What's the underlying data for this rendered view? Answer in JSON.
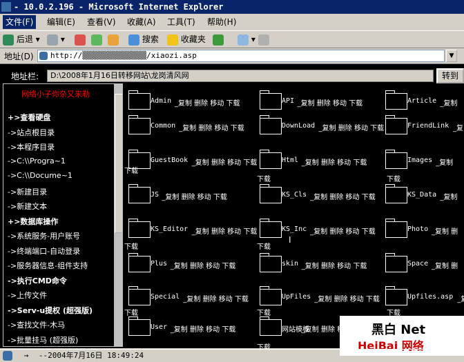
{
  "window": {
    "title": "- 10.0.2.196 - Microsoft Internet Explorer"
  },
  "menu": [
    "文件(F)",
    "编辑(E)",
    "查看(V)",
    "收藏(A)",
    "工具(T)",
    "帮助(H)"
  ],
  "toolbar": {
    "back": "后退",
    "search": "搜索",
    "favorites": "收藏夹"
  },
  "address": {
    "label": "地址(D)",
    "url": "http://▒▒▒▒▒▒▒▒▒▒▒▒▒▒/xiaozi.asp"
  },
  "page": {
    "addr_label": "地址栏:",
    "addr_value": "D:\\2008年1月16日转移网站\\龙岗清风网",
    "go_label": "转到",
    "banner": "网络小子你杂又来勒",
    "sidebar": [
      {
        "text": "+>查看硬盘",
        "bold": true
      },
      {
        "text": "->站点根目录",
        "bold": false
      },
      {
        "text": "->本程序目录",
        "bold": false
      },
      {
        "text": "->C:\\\\Progra~1",
        "bold": false
      },
      {
        "text": "->C:\\\\Docume~1",
        "bold": false
      },
      {
        "text": "->新建目录",
        "bold": false
      },
      {
        "text": "->新建文本",
        "bold": false
      },
      {
        "text": "+>数据库操作",
        "bold": true
      },
      {
        "text": "->系统服务-用户账号",
        "bold": false
      },
      {
        "text": "->终端端口-自动登录",
        "bold": false
      },
      {
        "text": "->服务器信息-组件支持",
        "bold": false
      },
      {
        "text": "->执行CMD命令",
        "bold": true
      },
      {
        "text": "->上传文件",
        "bold": false
      },
      {
        "text": "->Serv-u提权 (超强版)",
        "bold": true
      },
      {
        "text": "->查找文件-木马",
        "bold": false
      },
      {
        "text": "->批量挂马 (超强版)",
        "bold": false
      }
    ],
    "folders": [
      {
        "name": "Admin",
        "acts": "_复制 删除 移动 下载"
      },
      {
        "name": "API",
        "acts": "_复制 删除 移动 下载"
      },
      {
        "name": "Article",
        "acts": "_复制"
      },
      {
        "name": "Common",
        "acts": "_复制 删除 移动 下载"
      },
      {
        "name": "DownLoad",
        "acts": "_复制 删除 移动 下载"
      },
      {
        "name": "FriendLink",
        "acts": "_复"
      },
      {
        "name": "GuestBook",
        "acts": "_复制 删除 移动 下载"
      },
      {
        "name": "Html",
        "acts": "_复制 删除 移动 下载"
      },
      {
        "name": "Images",
        "acts": "_复制"
      },
      {
        "name": "JS",
        "acts": "_复制 删除 移动 下载"
      },
      {
        "name": "KS_Cls",
        "acts": "_复制 删除 移动 下载"
      },
      {
        "name": "KS_Data",
        "acts": "_复制"
      },
      {
        "name": "KS_Editor",
        "acts": "_复制 删除 移动 下载"
      },
      {
        "name": "KS_Inc",
        "acts": "_复制 删除 移动 下载"
      },
      {
        "name": "Photo",
        "acts": "_复制 删"
      },
      {
        "name": "Plus",
        "acts": "_复制 删除 移动 下载"
      },
      {
        "name": "skin",
        "acts": "_复制 删除 移动 下载"
      },
      {
        "name": "Space",
        "acts": "_复制 删"
      },
      {
        "name": "Special",
        "acts": "_复制 删除 移动 下载"
      },
      {
        "name": "UpFiles",
        "acts": "_复制 删除 移动 下载"
      },
      {
        "name": "Upfiles.asp",
        "acts": "_复制"
      },
      {
        "name": "User",
        "acts": "_复制 删除 移动 下载"
      },
      {
        "name": "网站模板",
        "acts": "_复制 删除 移动 下载"
      }
    ],
    "wrap_text": "下载",
    "logo_text": "黑白 Net",
    "logo_text2": "HeiBai 网络"
  },
  "status": {
    "text": "--2004年7月16日 18:49:24"
  },
  "colors": {
    "titlebar": "#0a246a",
    "banner": "#ff0000"
  }
}
